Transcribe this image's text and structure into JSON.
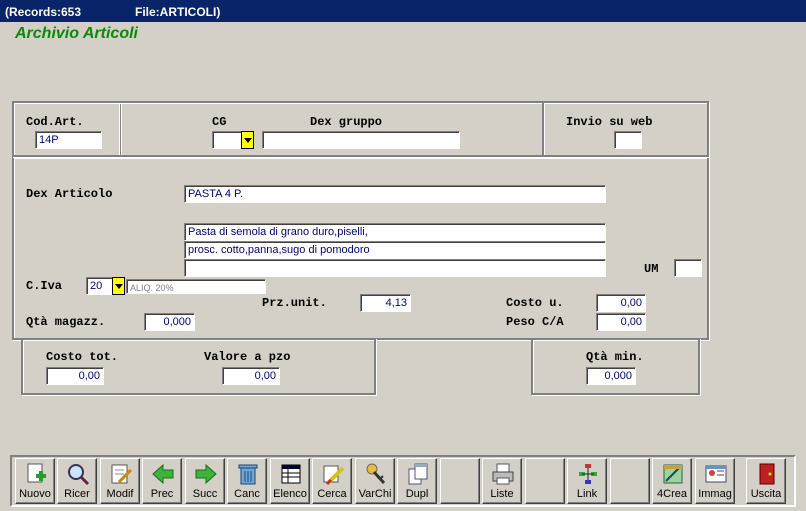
{
  "titlebar": {
    "records": "(Records:653",
    "file": "File:ARTICOLI)"
  },
  "app_title": "Archivio Articoli",
  "labels": {
    "cod_art": "Cod.Art.",
    "cg": "CG",
    "dex_gruppo": "Dex gruppo",
    "invio_web": "Invio su web",
    "dex_articolo": "Dex Articolo",
    "um": "UM",
    "civa": "C.Iva",
    "prz_unit": "Prz.unit.",
    "costo_u": "Costo u.",
    "qta_magazz": "Qtà magazz.",
    "peso_ca": "Peso C/A",
    "costo_tot": "Costo tot.",
    "valore_pzo": "Valore a pzo",
    "qta_min": "Qtà min."
  },
  "fields": {
    "cod_art": "14P",
    "cg": "",
    "dex_gruppo": "",
    "invio_web": "",
    "dex_articolo": "PASTA 4 P.",
    "desc_line1": "Pasta di semola di grano duro,piselli,",
    "desc_line2": "prosc. cotto,panna,sugo di pomodoro",
    "desc_line3": "",
    "um": "",
    "civa_code": "20",
    "civa_desc": "ALIQ. 20%",
    "prz_unit": "4,13",
    "costo_u": "0,00",
    "qta_magazz": "0,000",
    "peso_ca": "0,00",
    "costo_tot": "0,00",
    "valore_pzo": "0,00",
    "qta_min": "0,000"
  },
  "toolbar": [
    {
      "label": "Nuovo",
      "icon": "new-document-icon"
    },
    {
      "label": "Ricer",
      "icon": "magnifier-icon"
    },
    {
      "label": "Modif",
      "icon": "edit-document-icon"
    },
    {
      "label": "Prec",
      "icon": "arrow-left-icon"
    },
    {
      "label": "Succ",
      "icon": "arrow-right-icon"
    },
    {
      "label": "Canc",
      "icon": "trash-icon"
    },
    {
      "label": "Elenco",
      "icon": "table-list-icon"
    },
    {
      "label": "Cerca",
      "icon": "search-brush-icon"
    },
    {
      "label": "VarChi",
      "icon": "keys-icon"
    },
    {
      "label": "Dupl",
      "icon": "duplicate-icon"
    },
    {
      "label": "",
      "icon": ""
    },
    {
      "label": "Liste",
      "icon": "printer-icon"
    },
    {
      "label": "",
      "icon": ""
    },
    {
      "label": "Link",
      "icon": "network-icon"
    },
    {
      "label": "",
      "icon": ""
    },
    {
      "label": "4Crea",
      "icon": "create-icon"
    },
    {
      "label": "Immag",
      "icon": "image-card-icon"
    },
    {
      "label": "Uscita",
      "icon": "exit-door-icon"
    }
  ],
  "colors": {
    "title_bg": "#0a246a",
    "app_title": "#0a8a0a",
    "field_text": "#000080",
    "dropdown": "#ffff00"
  }
}
